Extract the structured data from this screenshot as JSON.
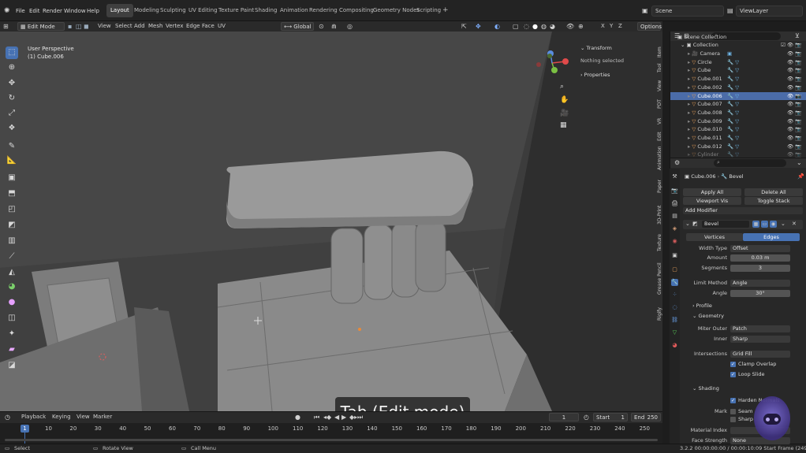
{
  "menubar": {
    "items": [
      "File",
      "Edit",
      "Render",
      "Window",
      "Help"
    ],
    "workspaces": [
      "Layout",
      "Modeling",
      "Sculpting",
      "UV Editing",
      "Texture Paint",
      "Shading",
      "Animation",
      "Rendering",
      "Compositing",
      "Geometry Nodes",
      "Scripting"
    ],
    "active_workspace": "Layout",
    "add_tab": "+",
    "scene": "Scene",
    "view_layer": "ViewLayer"
  },
  "viewport_header": {
    "mode": "Edit Mode",
    "menus": [
      "View",
      "Select",
      "Add",
      "Mesh",
      "Vertex",
      "Edge",
      "Face",
      "UV"
    ],
    "orientation": "Global",
    "options_label": "Options",
    "axes": [
      "X",
      "Y",
      "Z"
    ]
  },
  "viewport": {
    "perspective": "User Perspective",
    "object": "(1) Cube.006",
    "caption": "Tab (Edit mode)",
    "gizmo_axes": [
      "X",
      "Y",
      "Z"
    ],
    "side_tabs": [
      "Item",
      "Tool",
      "View",
      "PDT",
      "VR",
      "Edit",
      "Animation",
      "Paper",
      "3D-Print",
      "Texture",
      "Grease Pencil",
      "Rigify"
    ]
  },
  "npanel": {
    "transform_header": "Transform",
    "nothing_selected": "Nothing selected",
    "properties_header": "Properties"
  },
  "timeline": {
    "menus": [
      "Playback",
      "Keying",
      "View",
      "Marker"
    ],
    "current_frame": "1",
    "start_label": "Start",
    "start": "1",
    "end_label": "End",
    "end": "250",
    "ticks": [
      "10",
      "20",
      "30",
      "40",
      "50",
      "60",
      "70",
      "80",
      "90",
      "100",
      "110",
      "120",
      "130",
      "140",
      "150",
      "160",
      "170",
      "180",
      "190",
      "200",
      "210",
      "220",
      "230",
      "240",
      "250"
    ],
    "playhead": "1"
  },
  "statusbar": {
    "select": "Select",
    "rotate": "Rotate View",
    "call_menu": "Call Menu",
    "info": "3.2.2  00:00:00:00 / 00:00:10:09  Start Frame (249 left)"
  },
  "outliner": {
    "root": "Scene Collection",
    "collection": "Collection",
    "objects": [
      "Camera",
      "Circle",
      "Cube",
      "Cube.001",
      "Cube.002",
      "Cube.006",
      "Cube.007",
      "Cube.008",
      "Cube.009",
      "Cube.010",
      "Cube.011",
      "Cube.012",
      "Cylinder"
    ],
    "selected": "Cube.006"
  },
  "properties": {
    "breadcrumb_object": "Cube.006",
    "breadcrumb_modifier": "Bevel",
    "apply_all": "Apply All",
    "delete_all": "Delete All",
    "viewport_vis": "Viewport Vis",
    "toggle_stack": "Toggle Stack",
    "add_modifier": "Add Modifier",
    "modifier_name": "Bevel",
    "affect_vertices": "Vertices",
    "affect_edges": "Edges",
    "width_type_label": "Width Type",
    "width_type": "Offset",
    "amount_label": "Amount",
    "amount": "0.03 m",
    "segments_label": "Segments",
    "segments": "3",
    "limit_method_label": "Limit Method",
    "limit_method": "Angle",
    "angle_label": "Angle",
    "angle": "30°",
    "profile": "Profile",
    "geometry": "Geometry",
    "miter_outer_label": "Miter Outer",
    "miter_outer": "Patch",
    "inner_label": "Inner",
    "inner": "Sharp",
    "intersections_label": "Intersections",
    "intersections": "Grid Fill",
    "clamp_overlap": "Clamp Overlap",
    "loop_slide": "Loop Slide",
    "shading": "Shading",
    "harden_normals": "Harden Normals",
    "mark_label": "Mark",
    "seam": "Seam",
    "sharp": "Sharp",
    "material_index_label": "Material Index",
    "face_strength_label": "Face Strength",
    "face_strength": "None"
  },
  "colors": {
    "accent": "#4772b3",
    "selection": "#4b6ca8",
    "bg": "#1d1d1d"
  }
}
